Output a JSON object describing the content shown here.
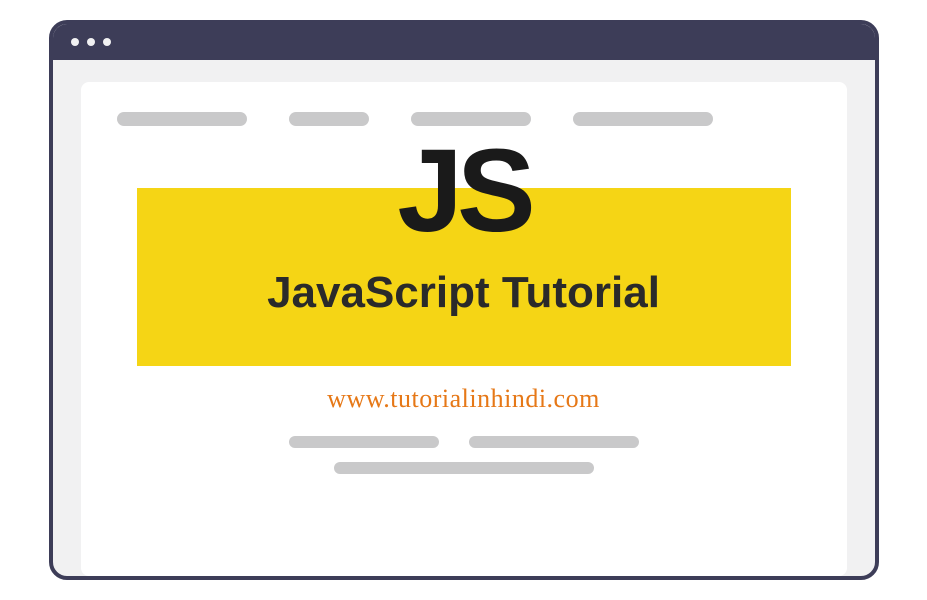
{
  "logo": "JS",
  "banner_title": "JavaScript Tutorial",
  "url": "www.tutorialinhindi.com"
}
